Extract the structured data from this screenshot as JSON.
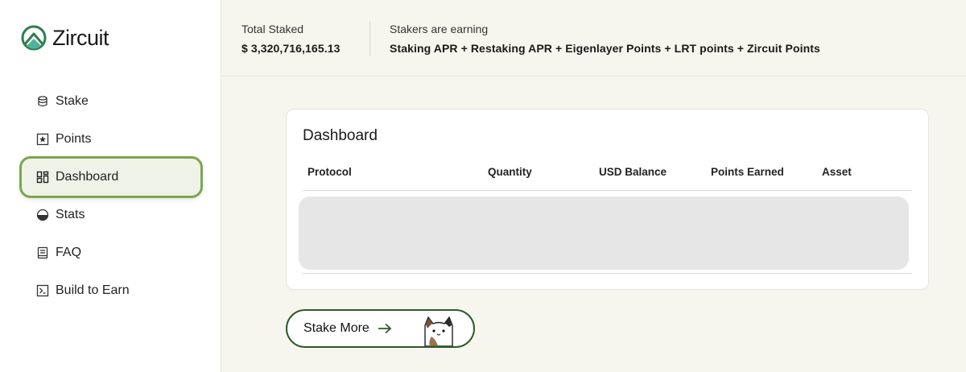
{
  "app": {
    "name": "Zircuit",
    "brand_color": "#2e7d4f",
    "accent_color": "#7aa650"
  },
  "sidebar": {
    "items": [
      {
        "label": "Stake",
        "icon": "coins-icon"
      },
      {
        "label": "Points",
        "icon": "star-box-icon"
      },
      {
        "label": "Dashboard",
        "icon": "dashboard-icon",
        "active": true
      },
      {
        "label": "Stats",
        "icon": "pie-icon"
      },
      {
        "label": "FAQ",
        "icon": "book-icon"
      },
      {
        "label": "Build to Earn",
        "icon": "terminal-icon"
      }
    ]
  },
  "header": {
    "total_staked_label": "Total Staked",
    "total_staked_value": "$ 3,320,716,165.13",
    "earning_label": "Stakers are earning",
    "earning_value": "Staking APR + Restaking APR + Eigenlayer Points + LRT points + Zircuit Points"
  },
  "dashboard": {
    "title": "Dashboard",
    "columns": [
      "Protocol",
      "Quantity",
      "USD Balance",
      "Points Earned",
      "Asset"
    ],
    "loading": true
  },
  "cta": {
    "stake_more_label": "Stake More",
    "icon": "arrow-right-icon",
    "mascot": "cat-mascot"
  }
}
